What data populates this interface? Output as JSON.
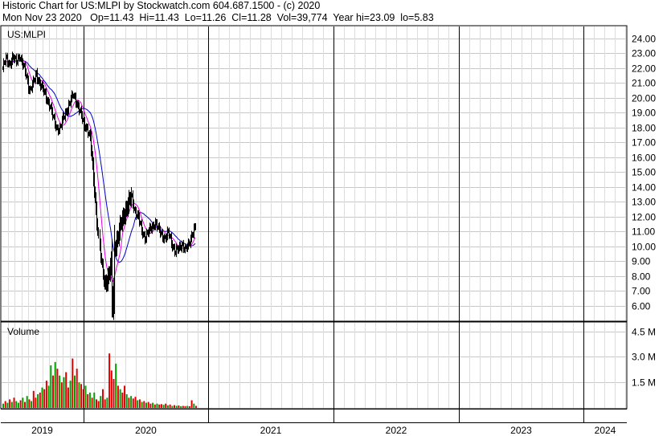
{
  "header": {
    "line1": "Historic Chart for US:MLPI by Stockwatch.com 604.687.1500 - (c) 2020",
    "line2": "Mon Nov 23 2020   Op=11.43  Hi=11.43  Lo=11.26  Cl=11.28  Vol=39,774  Year hi=23.09  lo=5.83"
  },
  "chart_data": [
    {
      "type": "line",
      "title": "US:MLPI",
      "ylim": [
        5.0,
        24.8
      ],
      "y_ticks": [
        "24.00",
        "23.00",
        "22.00",
        "21.00",
        "20.00",
        "19.00",
        "18.00",
        "17.00",
        "16.00",
        "15.00",
        "14.00",
        "13.00",
        "12.00",
        "11.00",
        "10.00",
        "9.00",
        "8.00",
        "7.00",
        "6.00"
      ],
      "x_years": [
        "2019",
        "2020",
        "2021",
        "2022",
        "2023",
        "2024"
      ],
      "grid": true,
      "colors": {
        "price": "#000000",
        "ma_short": "#e000e0",
        "ma_long": "#0000c8"
      },
      "series": [
        {
          "values": [
            22.0,
            22.6,
            22.3,
            22.7,
            22.4,
            22.9,
            22.2,
            21.5,
            20.5,
            20.9,
            21.6,
            21.0,
            20.5,
            20.0,
            19.5,
            18.6,
            18.0,
            17.9,
            18.6,
            19.2,
            19.7,
            20.2,
            19.7,
            19.0,
            18.3,
            18.0,
            17.2,
            14.5,
            11.5,
            9.0,
            7.5,
            7.8,
            8.8,
            9.9,
            10.6,
            11.6,
            12.3,
            12.8,
            13.4,
            12.4,
            11.9,
            11.1,
            10.6,
            10.9,
            11.3,
            11.6,
            11.1,
            10.8,
            10.5,
            10.9,
            10.2,
            9.6,
            9.8,
            10.2,
            9.7,
            10.1,
            10.9,
            11.3
          ]
        }
      ]
    },
    {
      "type": "bar",
      "title": "Volume",
      "ylim": [
        0,
        5.0
      ],
      "y_ticks": [
        "4.5 M",
        "3.0 M",
        "1.5 M"
      ],
      "colors": {
        "up": "#00a000",
        "down": "#e00000"
      },
      "series": [
        {
          "values": [
            0.25,
            0.4,
            0.3,
            0.5,
            0.35,
            0.6,
            0.4,
            0.3,
            0.45,
            0.6,
            0.35,
            0.7,
            0.5,
            0.4,
            1.0,
            0.6,
            0.8,
            0.9,
            1.2,
            1.1,
            1.6,
            1.3,
            2.5,
            1.9,
            2.7,
            2.3,
            1.9,
            1.5,
            1.8,
            2.1,
            1.2,
            1.6,
            2.9,
            1.9,
            2.3,
            1.5,
            1.4,
            1.1,
            1.3,
            0.8,
            0.9,
            0.6,
            0.9,
            0.5,
            0.4,
            0.7,
            1.1,
            0.5,
            0.6,
            3.2,
            2.2,
            1.7,
            2.6,
            1.3,
            1.1,
            0.9,
            1.3,
            0.8,
            0.6,
            0.7,
            0.55,
            0.65,
            0.45,
            0.5,
            0.35,
            0.4,
            0.3,
            0.35,
            0.25,
            0.3,
            0.2,
            0.25,
            0.2,
            0.22,
            0.18,
            0.25,
            0.15,
            0.2,
            0.12,
            0.16,
            0.12,
            0.14,
            0.1,
            0.12,
            0.1,
            0.12,
            0.1,
            0.45,
            0.25,
            0.12
          ],
          "up": [
            1,
            0,
            1,
            0,
            1,
            0,
            1,
            1,
            0,
            1,
            0,
            1,
            0,
            1,
            0,
            0,
            1,
            0,
            1,
            0,
            0,
            1,
            1,
            0,
            1,
            0,
            1,
            0,
            1,
            0,
            0,
            1,
            0,
            1,
            0,
            1,
            0,
            0,
            1,
            0,
            1,
            0,
            1,
            0,
            0,
            1,
            0,
            0,
            1,
            0,
            0,
            0,
            1,
            0,
            1,
            0,
            0,
            1,
            0,
            1,
            0,
            0,
            1,
            0,
            1,
            0,
            1,
            0,
            0,
            1,
            0,
            1,
            0,
            0,
            1,
            0,
            1,
            0,
            1,
            0,
            1,
            0,
            1,
            0,
            0,
            1,
            0,
            0,
            1,
            0
          ]
        }
      ]
    }
  ]
}
